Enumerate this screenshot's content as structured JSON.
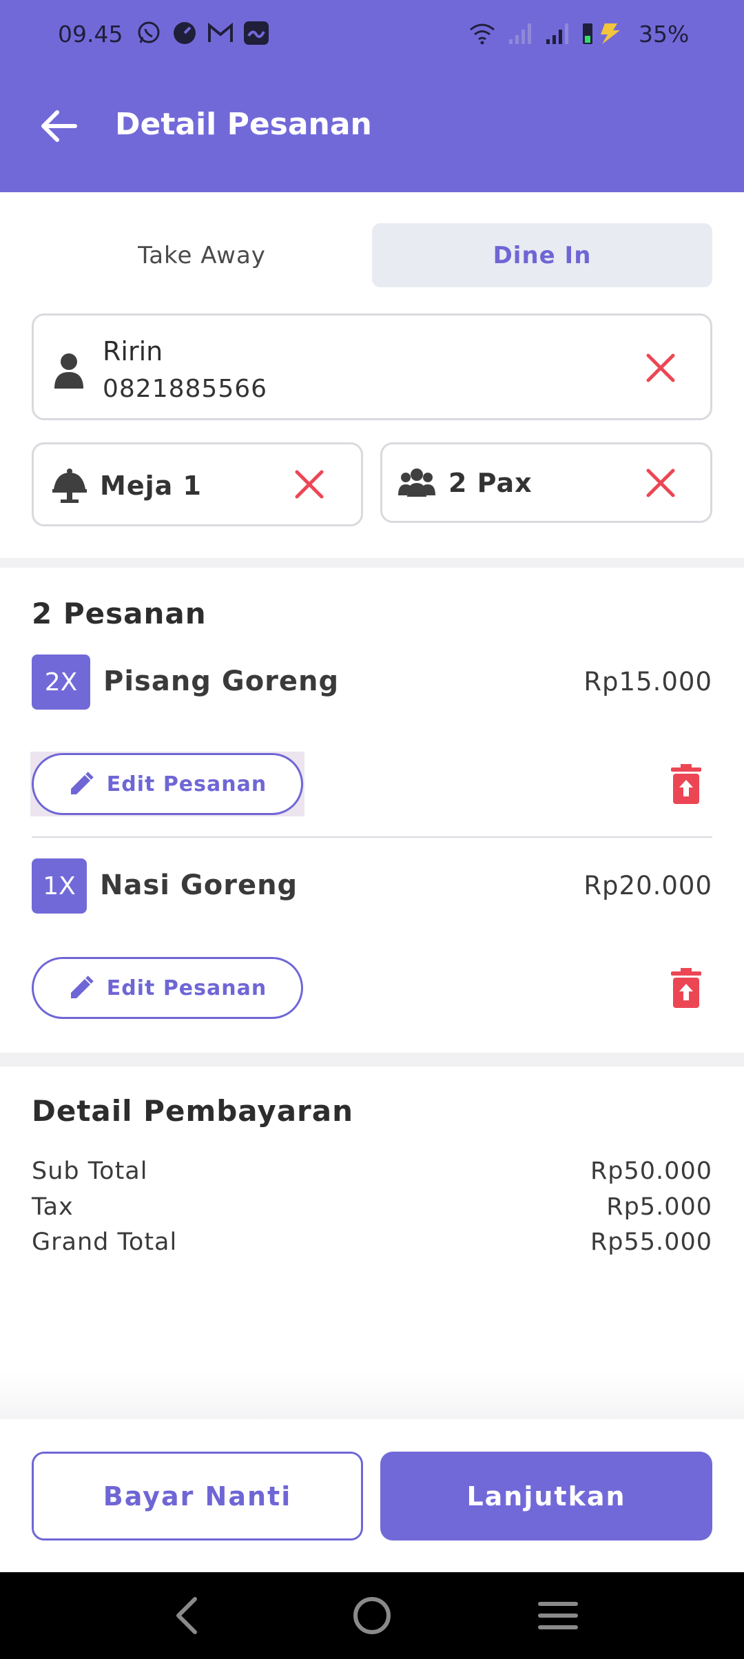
{
  "status_bar": {
    "time": "09.45",
    "battery": "35%",
    "icons": [
      "whatsapp-icon",
      "gauge-icon",
      "gmail-icon",
      "app-icon",
      "wifi-icon",
      "signal-icon",
      "signal-icon",
      "battery-icon"
    ]
  },
  "header": {
    "title": "Detail Pesanan",
    "back_icon": "arrow-left-icon"
  },
  "order_type": {
    "tabs": [
      {
        "label": "Take Away",
        "selected": false
      },
      {
        "label": "Dine In",
        "selected": true
      }
    ]
  },
  "customer": {
    "name": "Ririn",
    "phone": "0821885566"
  },
  "table": {
    "label": "Meja 1"
  },
  "pax": {
    "label": "2 Pax"
  },
  "orders": {
    "title": "2 Pesanan",
    "items": [
      {
        "qty": "2X",
        "name": "Pisang Goreng",
        "price": "Rp15.000",
        "edit_label": "Edit Pesanan"
      },
      {
        "qty": "1X",
        "name": "Nasi Goreng",
        "price": "Rp20.000",
        "edit_label": "Edit Pesanan"
      }
    ]
  },
  "payment": {
    "title": "Detail Pembayaran",
    "rows": [
      {
        "label": "Sub Total",
        "value": "Rp50.000"
      },
      {
        "label": "Tax",
        "value": "Rp5.000"
      },
      {
        "label": "Grand Total",
        "value": "Rp55.000"
      }
    ]
  },
  "actions": {
    "pay_later": "Bayar Nanti",
    "continue": "Lanjutkan"
  },
  "colors": {
    "primary": "#7269d9",
    "danger": "#ec4654",
    "tab_selected_bg": "#e9ebf3"
  }
}
